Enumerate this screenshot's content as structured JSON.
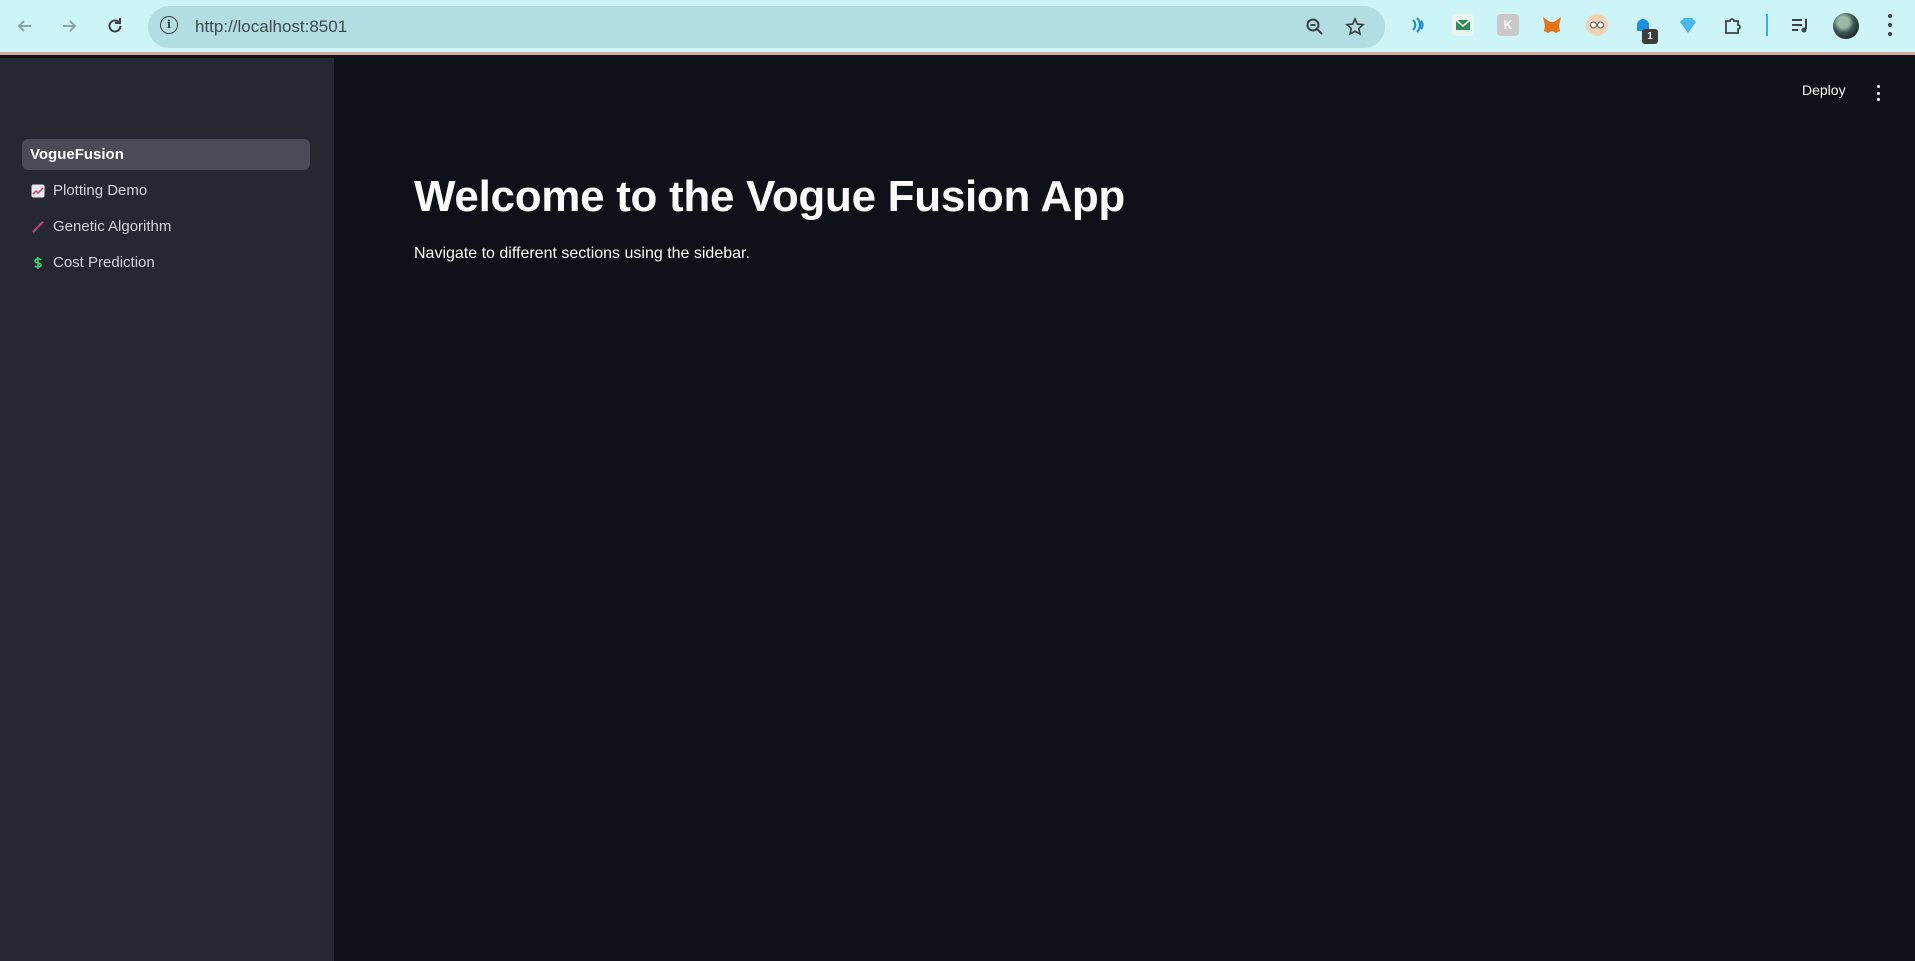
{
  "browser": {
    "url": "http://localhost:8501",
    "extension_badge_count": "1",
    "icons": [
      "back-icon",
      "forward-icon",
      "reload-icon",
      "site-info-icon",
      "zoom-icon",
      "bookmark-star-icon",
      "extensions-puzzle-icon",
      "media-controls-icon",
      "profile-avatar",
      "menu-kebab-icon"
    ]
  },
  "app": {
    "header": {
      "deploy_label": "Deploy"
    },
    "sidebar": {
      "items": [
        {
          "label": "VogueFusion",
          "active": true,
          "icon": ""
        },
        {
          "label": "Plotting Demo",
          "active": false,
          "icon": "chart-increasing-icon"
        },
        {
          "label": "Genetic Algorithm",
          "active": false,
          "icon": "dna-icon"
        },
        {
          "label": "Cost Prediction",
          "active": false,
          "icon": "dollar-sign-icon"
        }
      ]
    },
    "main": {
      "title": "Welcome to the Vogue Fusion App",
      "subtitle": "Navigate to different sections using the sidebar."
    }
  },
  "colors": {
    "toolbar_bg": "#cdf4f6",
    "omnibox_bg": "#b2dde2",
    "sidebar_bg": "#262730",
    "main_bg": "#0e1117",
    "active_item_bg": "#4a4b56",
    "text": "#fafafa"
  }
}
